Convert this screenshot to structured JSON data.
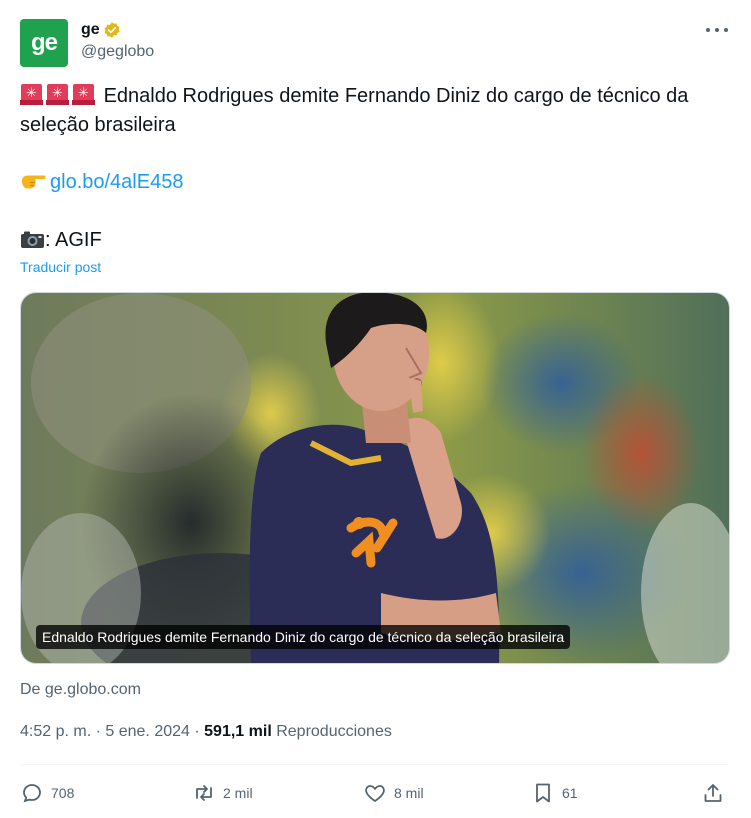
{
  "author": {
    "avatar_text": "ge",
    "display_name": "ge",
    "handle": "@geglobo",
    "verified_icon": "verified-badge-icon",
    "avatar_color": "#1fa14d"
  },
  "post": {
    "headline": "Ednaldo Rodrigues demite Fernando Diniz do cargo de técnico da seleção brasileira",
    "link_text": "glo.bo/4alE458",
    "photo_credit": ": AGIF",
    "translate_label": "Traducir post"
  },
  "media": {
    "caption": "Ednaldo Rodrigues demite Fernando Diniz do cargo de técnico da seleção brasileira"
  },
  "source_text": "De ge.globo.com",
  "meta": {
    "time": "4:52 p. m.",
    "separator": "·",
    "date": "5 ene. 2024",
    "views_count": "591,1 mil",
    "views_label": "Reproducciones"
  },
  "actions": {
    "replies": "708",
    "reposts": "2 mil",
    "likes": "8 mil",
    "bookmarks": "61"
  },
  "colors": {
    "link": "#1d9bf0",
    "secondary_text": "#536471",
    "verified": "#e2b719"
  }
}
